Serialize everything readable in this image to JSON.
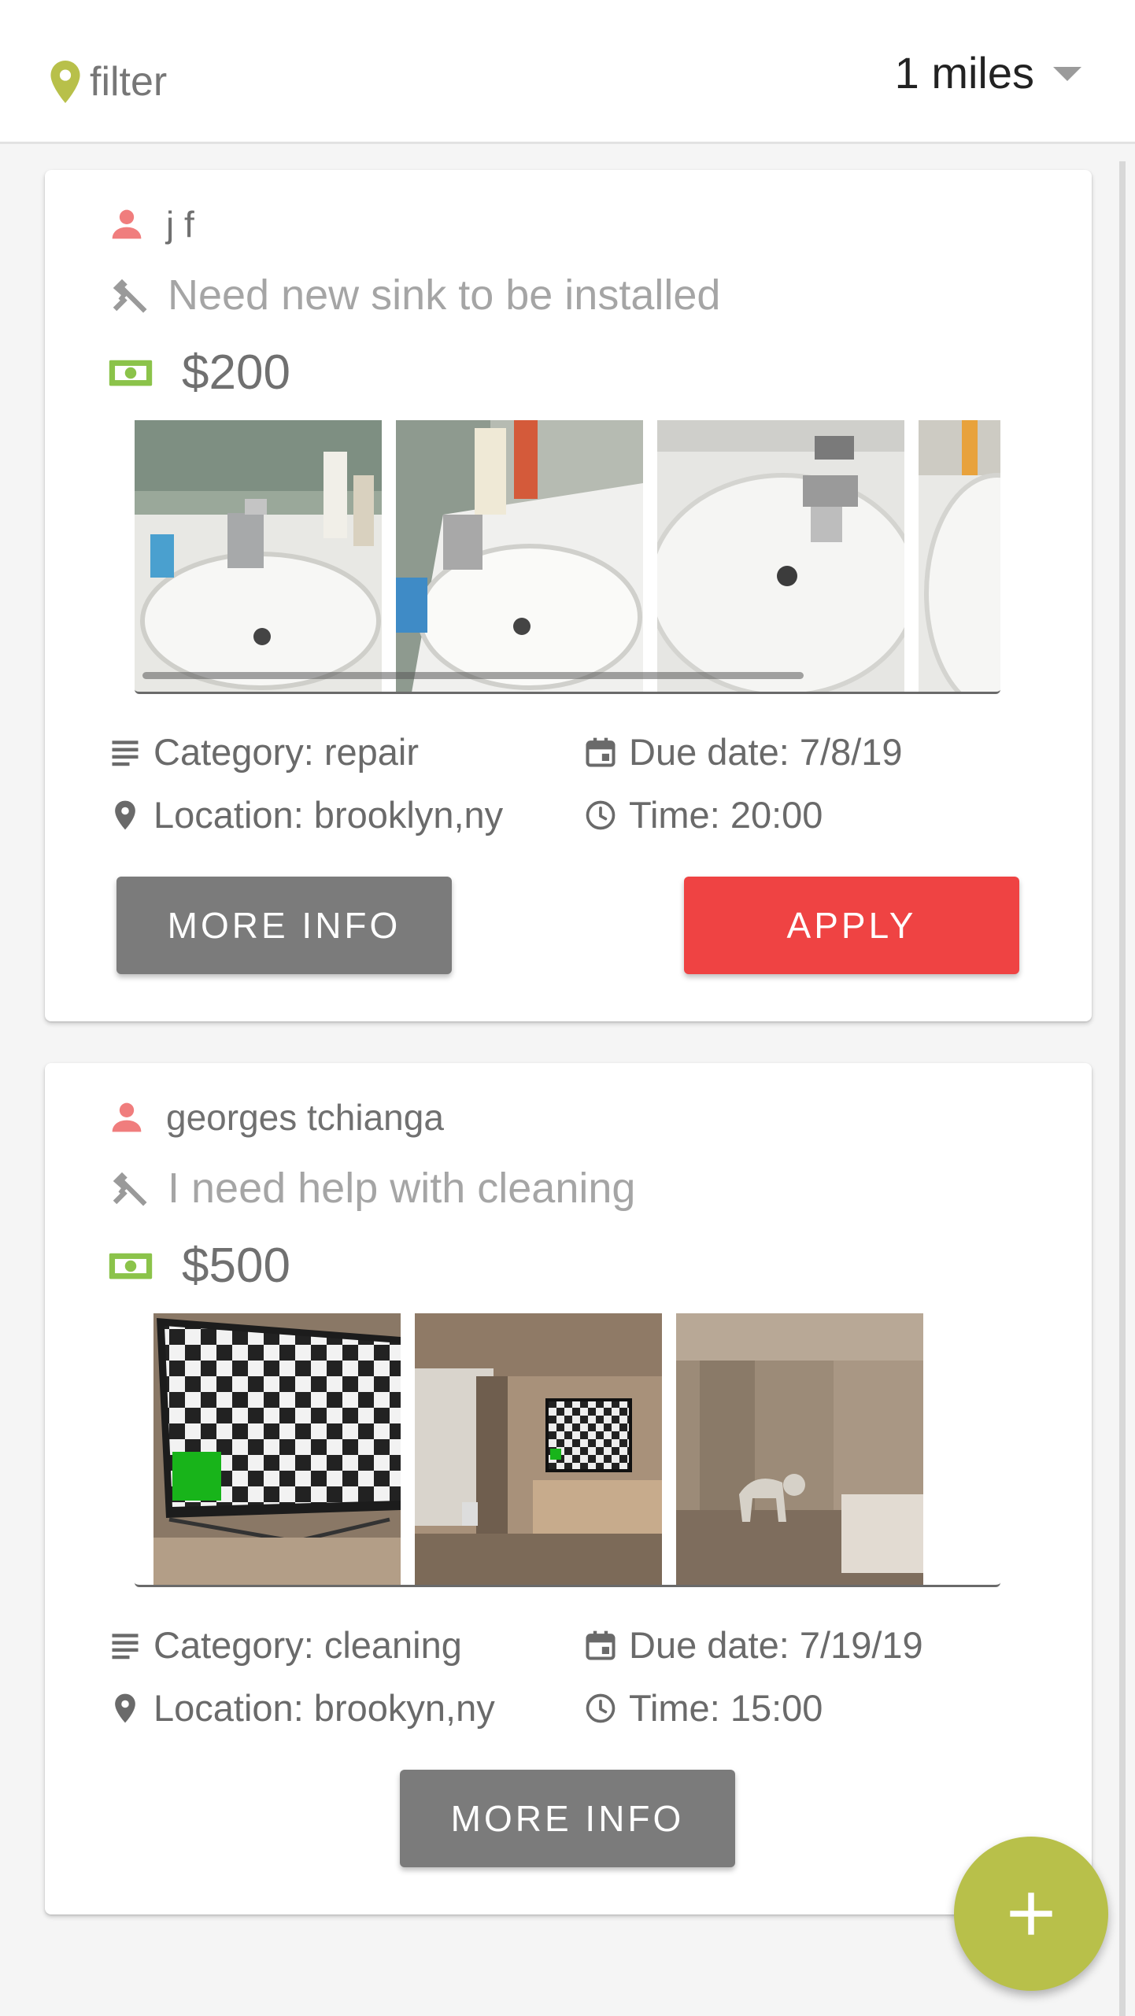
{
  "header": {
    "filter_label": "filter",
    "distance_value": "1 miles"
  },
  "colors": {
    "accent": "#b8c04a",
    "apply": "#ef4343",
    "more_info": "#7b7b7b",
    "user_icon": "#f07d7d",
    "money_icon": "#8bc34a"
  },
  "jobs": [
    {
      "user": "j f",
      "title": "Need new sink to be installed",
      "price": "$200",
      "category": "Category: repair",
      "location": "Location: brooklyn,ny",
      "due_date": "Due date: 7/8/19",
      "time": "Time: 20:00",
      "more_info_label": "MORE INFO",
      "apply_label": "APPLY",
      "images": [
        "sink-photo-1",
        "sink-photo-2",
        "sink-photo-3",
        "sink-photo-4"
      ]
    },
    {
      "user": "georges tchianga",
      "title": "I need help with cleaning",
      "price": "$500",
      "category": "Category: cleaning",
      "location": "Location: brookyn,ny",
      "due_date": "Due date: 7/19/19",
      "time": "Time: 15:00",
      "more_info_label": "MORE INFO",
      "images": [
        "tv-checkerboard-photo",
        "living-room-tv-photo",
        "room-dog-photo"
      ]
    }
  ],
  "icons": {
    "location": "map-pin-icon",
    "distance_dropdown": "caret-down-icon",
    "user": "person-icon",
    "title": "hammer-icon",
    "price": "cash-icon",
    "category": "list-icon",
    "due_date": "calendar-icon",
    "location_meta": "map-pin-icon",
    "time": "clock-icon",
    "fab": "plus-icon"
  }
}
